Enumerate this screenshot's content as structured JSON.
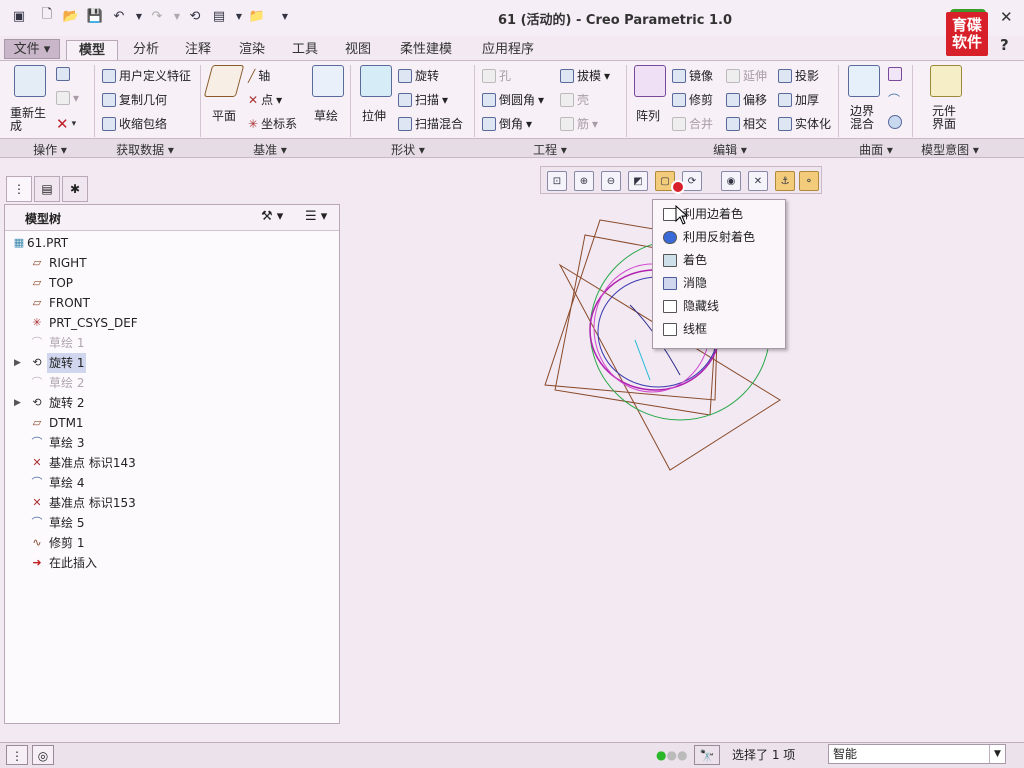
{
  "window": {
    "title": "61 (活动的) - Creo Parametric 1.0",
    "logo_text": "育碟软件",
    "help": "?"
  },
  "tabs": [
    "文件",
    "模型",
    "分析",
    "注释",
    "渲染",
    "工具",
    "视图",
    "柔性建模",
    "应用程序"
  ],
  "ribbon": {
    "regen": "重新生成",
    "user_feature": "用户定义特征",
    "copy_geom": "复制几何",
    "shrinkwrap": "收缩包络",
    "plane": "平面",
    "axis": "轴",
    "point": "点",
    "csys": "坐标系",
    "sketch": "草绘",
    "extrude": "拉伸",
    "revolve": "旋转",
    "sweep": "扫描",
    "swept_blend": "扫描混合",
    "hole": "孔",
    "round": "倒圆角",
    "chamfer": "倒角",
    "draft": "拔模",
    "shell": "壳",
    "rib": "筋",
    "pattern": "阵列",
    "mirror": "镜像",
    "trim": "修剪",
    "merge": "合并",
    "extend": "延伸",
    "offset": "偏移",
    "intersect": "相交",
    "project": "投影",
    "thicken": "加厚",
    "solidify": "实体化",
    "boundary_blend": "边界混合",
    "component_interface": "元件界面"
  },
  "groups": [
    "操作",
    "获取数据",
    "基准",
    "形状",
    "工程",
    "编辑",
    "曲面",
    "模型意图"
  ],
  "model_tree": {
    "title": "模型树",
    "items": [
      {
        "label": "61.PRT",
        "icon": "part-icon",
        "dim": false,
        "expand": false
      },
      {
        "label": "RIGHT",
        "icon": "datum-plane-icon",
        "dim": false,
        "expand": false
      },
      {
        "label": "TOP",
        "icon": "datum-plane-icon",
        "dim": false,
        "expand": false
      },
      {
        "label": "FRONT",
        "icon": "datum-plane-icon",
        "dim": false,
        "expand": false
      },
      {
        "label": "PRT_CSYS_DEF",
        "icon": "csys-icon",
        "dim": false,
        "expand": false
      },
      {
        "label": "草绘 1",
        "icon": "sketch-icon",
        "dim": true,
        "expand": false
      },
      {
        "label": "旋转 1",
        "icon": "revolve-icon",
        "dim": false,
        "expand": true,
        "selected": true
      },
      {
        "label": "草绘 2",
        "icon": "sketch-icon",
        "dim": true,
        "expand": false
      },
      {
        "label": "旋转 2",
        "icon": "revolve-icon",
        "dim": false,
        "expand": true
      },
      {
        "label": "DTM1",
        "icon": "datum-plane-icon",
        "dim": false,
        "expand": false
      },
      {
        "label": "草绘 3",
        "icon": "sketch-icon",
        "dim": false,
        "expand": false
      },
      {
        "label": "基准点 标识143",
        "icon": "datum-point-icon",
        "dim": false,
        "expand": false
      },
      {
        "label": "草绘 4",
        "icon": "sketch-icon",
        "dim": false,
        "expand": false
      },
      {
        "label": "基准点 标识153",
        "icon": "datum-point-icon",
        "dim": false,
        "expand": false
      },
      {
        "label": "草绘 5",
        "icon": "sketch-icon",
        "dim": false,
        "expand": false
      },
      {
        "label": "修剪 1",
        "icon": "trim-icon",
        "dim": false,
        "expand": false
      },
      {
        "label": "在此插入",
        "icon": "insert-here-icon",
        "dim": false,
        "expand": false
      }
    ]
  },
  "display_menu": {
    "items": [
      "利用边着色",
      "利用反射着色",
      "着色",
      "消隐",
      "隐藏线",
      "线框"
    ],
    "highlighted_index": 3
  },
  "status": {
    "selection": "选择了 1 项",
    "filter": "智能"
  },
  "colors": {
    "accent": "#cfd6ee",
    "background": "#f2e9f2",
    "logo_red": "#d8202a"
  }
}
